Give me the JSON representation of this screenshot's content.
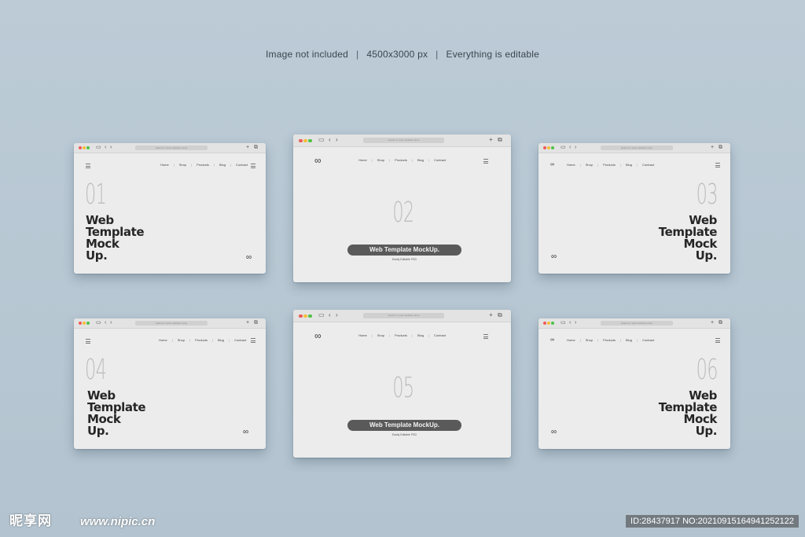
{
  "caption": {
    "left": "Image not included",
    "mid": "4500x3000 px",
    "right": "Everything is editable",
    "sep": "|"
  },
  "browser": {
    "url": "Search or enter website name",
    "back": "‹",
    "fwd": "›",
    "plus": "+",
    "nav": [
      "Home",
      "Shop",
      "Products",
      "Blog",
      "Contract"
    ],
    "nav_sep": "|",
    "logo": "∞"
  },
  "mockups": [
    {
      "num": "01",
      "line1": "Web",
      "line2": "Template",
      "line3": "Mock",
      "line4": "Up."
    },
    {
      "num": "02",
      "pill": "Web Template MockUp.",
      "sub": "Easily Editable PSD"
    },
    {
      "num": "03",
      "line1": "Web",
      "line2": "Template",
      "line3": "Mock",
      "line4": "Up."
    },
    {
      "num": "04",
      "line1": "Web",
      "line2": "Template",
      "line3": "Mock",
      "line4": "Up."
    },
    {
      "num": "05",
      "pill": "Web Template MockUp.",
      "sub": "Easily Editable PSD"
    },
    {
      "num": "06",
      "line1": "Web",
      "line2": "Template",
      "line3": "Mock",
      "line4": "Up."
    }
  ],
  "watermark": {
    "brand": "昵享网",
    "site": "www.nipic.cn",
    "id": "ID:28437917 NO:20210915164941252122"
  }
}
